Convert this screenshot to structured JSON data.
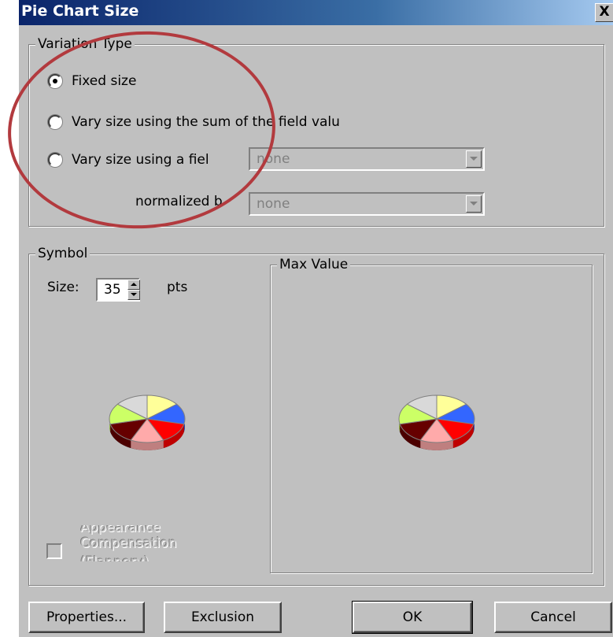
{
  "window": {
    "title": "Pie Chart Size",
    "close_label": "X"
  },
  "variation_type": {
    "legend": "Variation Type",
    "options": [
      {
        "label": "Fixed size",
        "checked": true
      },
      {
        "label": "Vary size using the sum of the field valu",
        "checked": false
      },
      {
        "label": "Vary size using a fiel",
        "checked": false
      }
    ],
    "field_combo": {
      "value": "none"
    },
    "normalized_label": "normalized b",
    "normalized_combo": {
      "value": "none"
    }
  },
  "symbol": {
    "legend": "Symbol",
    "size_label": "Size:",
    "size_value": "35",
    "size_unit": "pts",
    "appearance_label": [
      "Appearance",
      "Compensation",
      "(Flannery)"
    ],
    "appearance_checked": false
  },
  "max_value": {
    "legend": "Max Value"
  },
  "pie_colors": {
    "slices": [
      "#ffff99",
      "#3366ff",
      "#ff0000",
      "#ffaaaa",
      "#660000",
      "#ccff66",
      "#d9d9d9"
    ],
    "shadow": "#000000"
  },
  "buttons": {
    "properties": "Properties...",
    "exclusion": "Exclusion",
    "ok": "OK",
    "cancel": "Cancel"
  },
  "annotation_color": "#b23a3e"
}
